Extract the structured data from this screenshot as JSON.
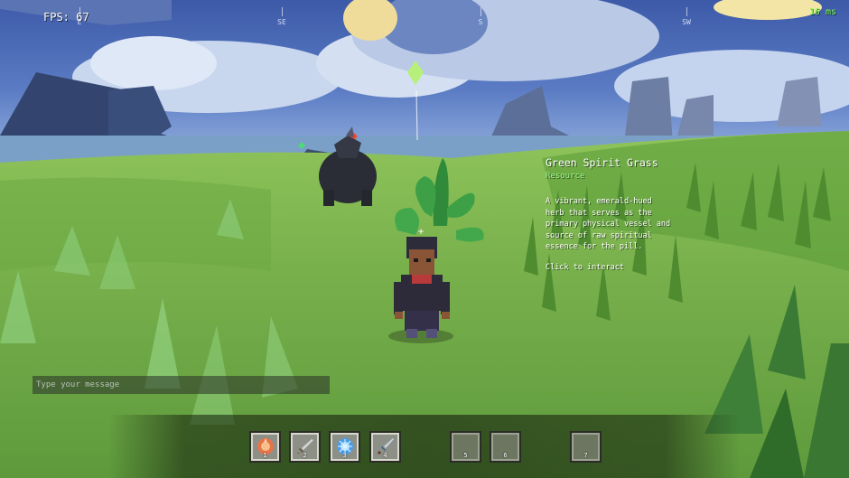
{
  "hud": {
    "fps": "FPS: 67",
    "ping": "16 ms",
    "compass": [
      "E",
      "SE",
      "S",
      "SW"
    ]
  },
  "tooltip": {
    "title": "Green Spirit Grass",
    "type": "Resource",
    "description": "A vibrant, emerald-hued herb that serves as the primary physical vessel and source of raw spiritual essence for the pill.",
    "hint": "Click to interact"
  },
  "chat": {
    "placeholder": "Type your message"
  },
  "hotbar": {
    "slots": [
      {
        "number": "1",
        "icon": "fire-orb-icon"
      },
      {
        "number": "2",
        "icon": "sword-icon"
      },
      {
        "number": "3",
        "icon": "ice-orb-icon"
      },
      {
        "number": "4",
        "icon": "dagger-icon"
      },
      {
        "number": "5",
        "icon": ""
      },
      {
        "number": "6",
        "icon": ""
      },
      {
        "number": "7",
        "icon": ""
      }
    ]
  },
  "colors": {
    "ping": "#7dff4a",
    "resource_type": "#9dfb8c",
    "grass": "#6fa648",
    "sky": "#4a6fb8"
  }
}
